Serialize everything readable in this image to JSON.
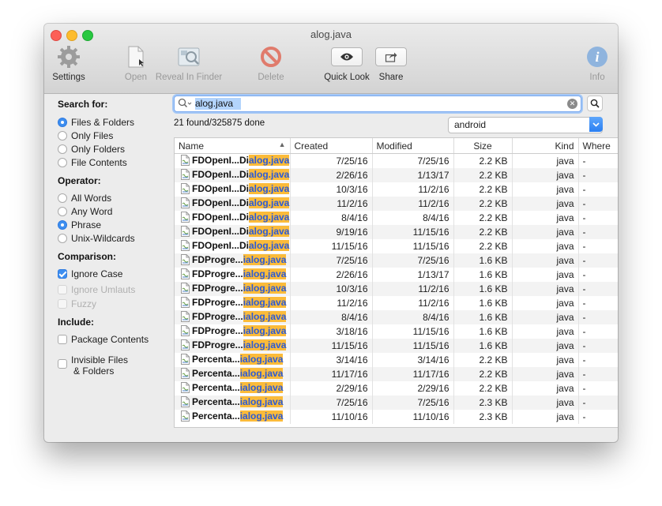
{
  "window": {
    "title": "alog.java"
  },
  "toolbar": {
    "settings": "Settings",
    "open": "Open",
    "reveal": "Reveal In Finder",
    "delete": "Delete",
    "quicklook": "Quick Look",
    "share": "Share",
    "info": "Info"
  },
  "sidebar": {
    "search_for": "Search for:",
    "files_folders": "Files & Folders",
    "only_files": "Only Files",
    "only_folders": "Only Folders",
    "file_contents": "File Contents",
    "operator": "Operator:",
    "all_words": "All Words",
    "any_word": "Any Word",
    "phrase": "Phrase",
    "unix_wildcards": "Unix-Wildcards",
    "comparison": "Comparison:",
    "ignore_case": "Ignore Case",
    "ignore_umlauts": "Ignore Umlauts",
    "fuzzy": "Fuzzy",
    "include": "Include:",
    "package_contents": "Package Contents",
    "invisible_1": "Invisible Files",
    "invisible_2": "& Folders"
  },
  "search": {
    "value": "alog.java",
    "status": "21 found/325875 done",
    "scope": "android"
  },
  "table": {
    "headers": {
      "name": "Name",
      "created": "Created",
      "modified": "Modified",
      "size": "Size",
      "kind": "Kind",
      "where": "Where"
    },
    "rows": [
      {
        "prefix": "FDOpenI...Di",
        "match": "alog.java",
        "created": "7/25/16",
        "modified": "7/25/16",
        "size": "2.2 KB",
        "kind": "java",
        "where": "-"
      },
      {
        "prefix": "FDOpenI...Di",
        "match": "alog.java",
        "created": "2/26/16",
        "modified": "1/13/17",
        "size": "2.2 KB",
        "kind": "java",
        "where": "-"
      },
      {
        "prefix": "FDOpenI...Di",
        "match": "alog.java",
        "created": "10/3/16",
        "modified": "11/2/16",
        "size": "2.2 KB",
        "kind": "java",
        "where": "-"
      },
      {
        "prefix": "FDOpenI...Di",
        "match": "alog.java",
        "created": "11/2/16",
        "modified": "11/2/16",
        "size": "2.2 KB",
        "kind": "java",
        "where": "-"
      },
      {
        "prefix": "FDOpenI...Di",
        "match": "alog.java",
        "created": "8/4/16",
        "modified": "8/4/16",
        "size": "2.2 KB",
        "kind": "java",
        "where": "-"
      },
      {
        "prefix": "FDOpenI...Di",
        "match": "alog.java",
        "created": "9/19/16",
        "modified": "11/15/16",
        "size": "2.2 KB",
        "kind": "java",
        "where": "-"
      },
      {
        "prefix": "FDOpenI...Di",
        "match": "alog.java",
        "created": "11/15/16",
        "modified": "11/15/16",
        "size": "2.2 KB",
        "kind": "java",
        "where": "-"
      },
      {
        "prefix": "FDProgre...",
        "match": "ialog.java",
        "created": "7/25/16",
        "modified": "7/25/16",
        "size": "1.6 KB",
        "kind": "java",
        "where": "-"
      },
      {
        "prefix": "FDProgre...",
        "match": "ialog.java",
        "created": "2/26/16",
        "modified": "1/13/17",
        "size": "1.6 KB",
        "kind": "java",
        "where": "-"
      },
      {
        "prefix": "FDProgre...",
        "match": "ialog.java",
        "created": "10/3/16",
        "modified": "11/2/16",
        "size": "1.6 KB",
        "kind": "java",
        "where": "-"
      },
      {
        "prefix": "FDProgre...",
        "match": "ialog.java",
        "created": "11/2/16",
        "modified": "11/2/16",
        "size": "1.6 KB",
        "kind": "java",
        "where": "-"
      },
      {
        "prefix": "FDProgre...",
        "match": "ialog.java",
        "created": "8/4/16",
        "modified": "8/4/16",
        "size": "1.6 KB",
        "kind": "java",
        "where": "-"
      },
      {
        "prefix": "FDProgre...",
        "match": "ialog.java",
        "created": "3/18/16",
        "modified": "11/15/16",
        "size": "1.6 KB",
        "kind": "java",
        "where": "-"
      },
      {
        "prefix": "FDProgre...",
        "match": "ialog.java",
        "created": "11/15/16",
        "modified": "11/15/16",
        "size": "1.6 KB",
        "kind": "java",
        "where": "-"
      },
      {
        "prefix": "Percenta...",
        "match": "ialog.java",
        "created": "3/14/16",
        "modified": "3/14/16",
        "size": "2.2 KB",
        "kind": "java",
        "where": "-"
      },
      {
        "prefix": "Percenta...",
        "match": "ialog.java",
        "created": "11/17/16",
        "modified": "11/17/16",
        "size": "2.2 KB",
        "kind": "java",
        "where": "-"
      },
      {
        "prefix": "Percenta...",
        "match": "ialog.java",
        "created": "2/29/16",
        "modified": "2/29/16",
        "size": "2.2 KB",
        "kind": "java",
        "where": "-"
      },
      {
        "prefix": "Percenta...",
        "match": "ialog.java",
        "created": "7/25/16",
        "modified": "7/25/16",
        "size": "2.3 KB",
        "kind": "java",
        "where": "-"
      },
      {
        "prefix": "Percenta...",
        "match": "ialog.java",
        "created": "11/10/16",
        "modified": "11/10/16",
        "size": "2.3 KB",
        "kind": "java",
        "where": "-"
      }
    ]
  }
}
